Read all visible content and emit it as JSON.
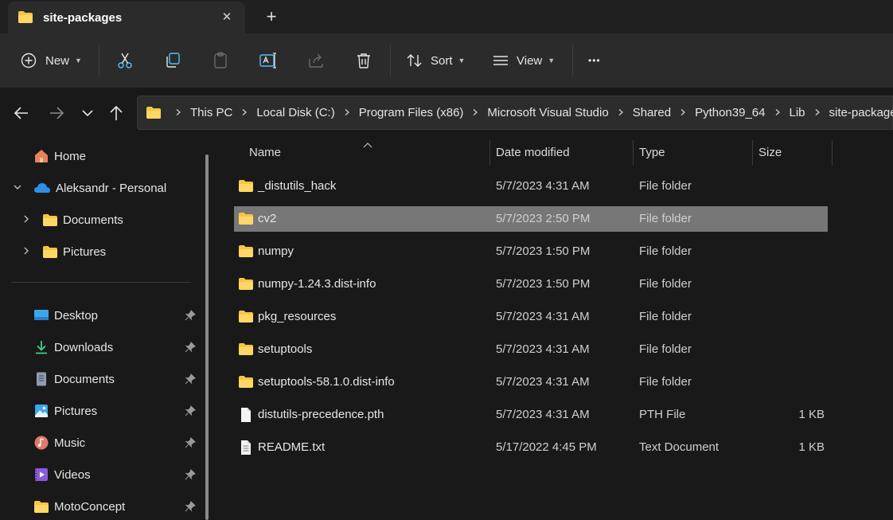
{
  "window": {
    "tab_title": "site-packages",
    "tab_close": "✕",
    "new_tab": "+"
  },
  "toolbar": {
    "new_label": "New",
    "sort_label": "Sort",
    "view_label": "View",
    "more_label": "•••"
  },
  "address": {
    "crumbs": [
      "This PC",
      "Local Disk (C:)",
      "Program Files (x86)",
      "Microsoft Visual Studio",
      "Shared",
      "Python39_64",
      "Lib",
      "site-packages"
    ]
  },
  "sidebar": {
    "home": "Home",
    "onedrive": "Aleksandr - Personal",
    "od_documents": "Documents",
    "od_pictures": "Pictures",
    "quick": [
      {
        "label": "Desktop",
        "icon": "desktop-icon"
      },
      {
        "label": "Downloads",
        "icon": "download-icon"
      },
      {
        "label": "Documents",
        "icon": "document-icon"
      },
      {
        "label": "Pictures",
        "icon": "pictures-icon"
      },
      {
        "label": "Music",
        "icon": "music-icon"
      },
      {
        "label": "Videos",
        "icon": "videos-icon"
      },
      {
        "label": "MotoConcept",
        "icon": "folder-icon"
      }
    ]
  },
  "columns": {
    "name": "Name",
    "date": "Date modified",
    "type": "Type",
    "size": "Size"
  },
  "files": [
    {
      "name": "_distutils_hack",
      "date": "5/7/2023 4:31 AM",
      "type": "File folder",
      "size": "",
      "kind": "folder"
    },
    {
      "name": "cv2",
      "date": "5/7/2023 2:50 PM",
      "type": "File folder",
      "size": "",
      "kind": "folder"
    },
    {
      "name": "numpy",
      "date": "5/7/2023 1:50 PM",
      "type": "File folder",
      "size": "",
      "kind": "folder"
    },
    {
      "name": "numpy-1.24.3.dist-info",
      "date": "5/7/2023 1:50 PM",
      "type": "File folder",
      "size": "",
      "kind": "folder"
    },
    {
      "name": "pkg_resources",
      "date": "5/7/2023 4:31 AM",
      "type": "File folder",
      "size": "",
      "kind": "folder"
    },
    {
      "name": "setuptools",
      "date": "5/7/2023 4:31 AM",
      "type": "File folder",
      "size": "",
      "kind": "folder"
    },
    {
      "name": "setuptools-58.1.0.dist-info",
      "date": "5/7/2023 4:31 AM",
      "type": "File folder",
      "size": "",
      "kind": "folder"
    },
    {
      "name": "distutils-precedence.pth",
      "date": "5/7/2023 4:31 AM",
      "type": "PTH File",
      "size": "1 KB",
      "kind": "file"
    },
    {
      "name": "README.txt",
      "date": "5/17/2022 4:45 PM",
      "type": "Text Document",
      "size": "1 KB",
      "kind": "text"
    }
  ],
  "selected_row": "cv2",
  "colors": {
    "folder": "#F8C542",
    "accent": "#4CC2FF",
    "selection": "#777777"
  }
}
